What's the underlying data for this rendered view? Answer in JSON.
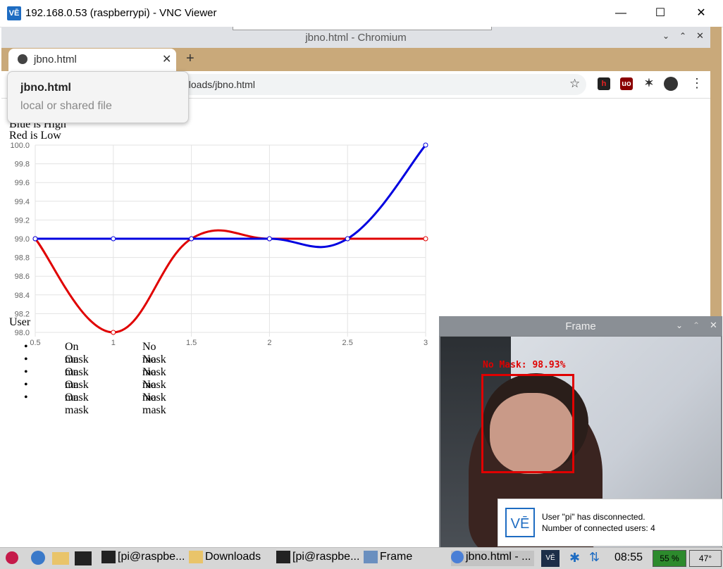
{
  "vnc": {
    "title": "192.168.0.53 (raspberrypi) - VNC Viewer",
    "logo": "VĒ",
    "minimize": "—",
    "maximize": "☐",
    "close": "✕"
  },
  "chromium": {
    "title": "jbno.html - Chromium",
    "tab_title": "jbno.html",
    "tab_close": "✕",
    "new_tab": "+",
    "url": "nloads/jbno.html",
    "popup_title": "jbno.html",
    "popup_subtitle": "local or shared file",
    "ext_labels": [
      "h",
      "uo",
      "✶"
    ]
  },
  "page": {
    "legend_line1": "Blue is High",
    "legend_line2": "Red is Low",
    "user_heading": "User",
    "users": [
      {
        "c1": "On mask",
        "c2": "No mask"
      },
      {
        "c1": "On mask",
        "c2": "No mask"
      },
      {
        "c1": "On mask",
        "c2": "No mask"
      },
      {
        "c1": "On mask",
        "c2": "No mask"
      },
      {
        "c1": "On mask",
        "c2": "No mask"
      }
    ]
  },
  "chart_data": {
    "type": "line",
    "x": [
      0.5,
      1,
      1.5,
      2,
      2.5,
      3
    ],
    "x_ticks": [
      "0.5",
      "1",
      "1.5",
      "2",
      "2.5",
      "3"
    ],
    "ylim": [
      98.0,
      100.0
    ],
    "y_ticks": [
      "98.0",
      "98.2",
      "98.4",
      "98.6",
      "98.8",
      "99.0",
      "99.2",
      "99.4",
      "99.6",
      "99.8",
      "100.0"
    ],
    "series": [
      {
        "color": "#0000e0",
        "values": [
          99.0,
          99.0,
          99.0,
          99.0,
          99.0,
          100.0
        ]
      },
      {
        "color": "#e00000",
        "values": [
          99.0,
          98.0,
          99.0,
          99.0,
          99.0,
          99.0
        ]
      }
    ],
    "grid": true
  },
  "frame": {
    "title": "Frame",
    "label": "No Mask: 98.93%",
    "notify_line1": "User \"pi\" has disconnected.",
    "notify_line2": "Number of connected users: 4"
  },
  "taskbar": {
    "items": [
      "[pi@raspbe...",
      "Downloads",
      "[pi@raspbe...",
      "Frame",
      "jbno.html - ..."
    ],
    "time": "08:55",
    "cpu": "55 %",
    "temp": "47°"
  }
}
